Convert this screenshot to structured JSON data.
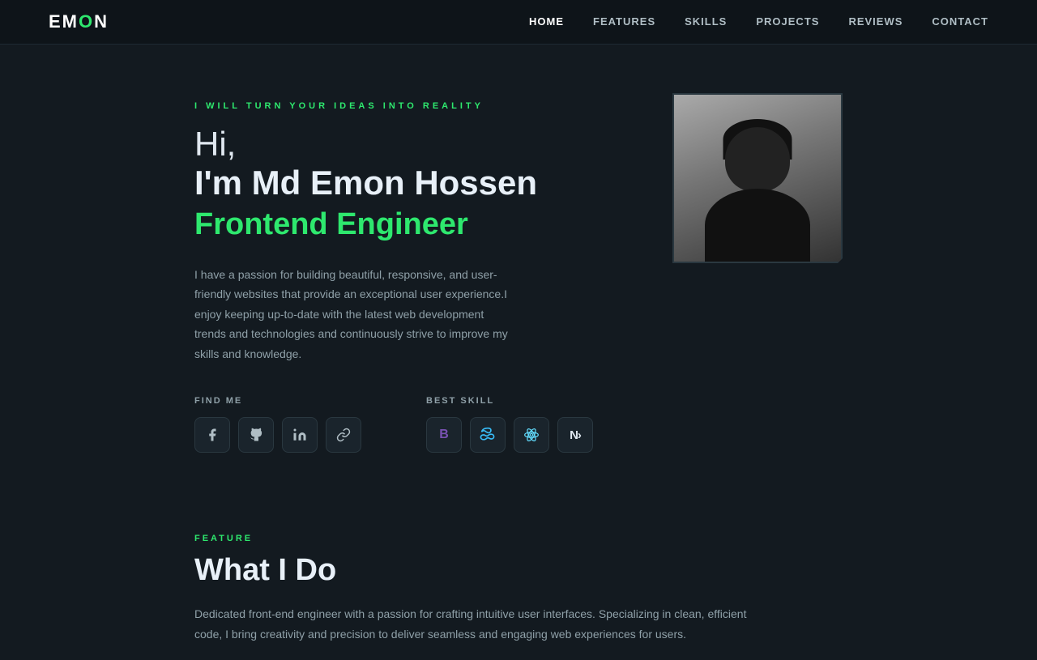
{
  "brand": {
    "logo_prefix": "EM",
    "logo_highlight": "O",
    "logo_suffix": "N"
  },
  "nav": {
    "links": [
      {
        "label": "HOME",
        "active": true
      },
      {
        "label": "FEATURES",
        "active": false
      },
      {
        "label": "SKILLS",
        "active": false
      },
      {
        "label": "PROJECTS",
        "active": false
      },
      {
        "label": "REVIEWS",
        "active": false
      },
      {
        "label": "CONTACT",
        "active": false
      }
    ]
  },
  "hero": {
    "tagline": "I  WILL  TURN  YOUR  IDEAS  INTO  REALITY",
    "greeting": "Hi,",
    "name": "I'm Md Emon Hossen",
    "role": "Frontend Engineer",
    "description": "I have a passion for building beautiful, responsive, and user-friendly websites that provide an exceptional user experience.I enjoy keeping up-to-date with the latest web development trends and technologies and continuously strive to improve my skills and knowledge.",
    "find_me_label": "FIND  ME",
    "best_skill_label": "BEST  SKILL",
    "social": [
      {
        "name": "facebook",
        "symbol": "f"
      },
      {
        "name": "github",
        "symbol": "⌬"
      },
      {
        "name": "linkedin",
        "symbol": "in"
      },
      {
        "name": "external",
        "symbol": "↗"
      }
    ],
    "skills": [
      {
        "name": "bootstrap",
        "symbol": "B"
      },
      {
        "name": "tailwind",
        "symbol": "≋"
      },
      {
        "name": "react",
        "symbol": "⚛"
      },
      {
        "name": "nextjs",
        "symbol": "N"
      }
    ]
  },
  "feature": {
    "section_label": "FEATURE",
    "title": "What I Do",
    "description": "Dedicated front-end engineer with a passion for crafting intuitive user interfaces. Specializing in clean, efficient code, I bring creativity and precision to deliver seamless and engaging web experiences for users."
  }
}
